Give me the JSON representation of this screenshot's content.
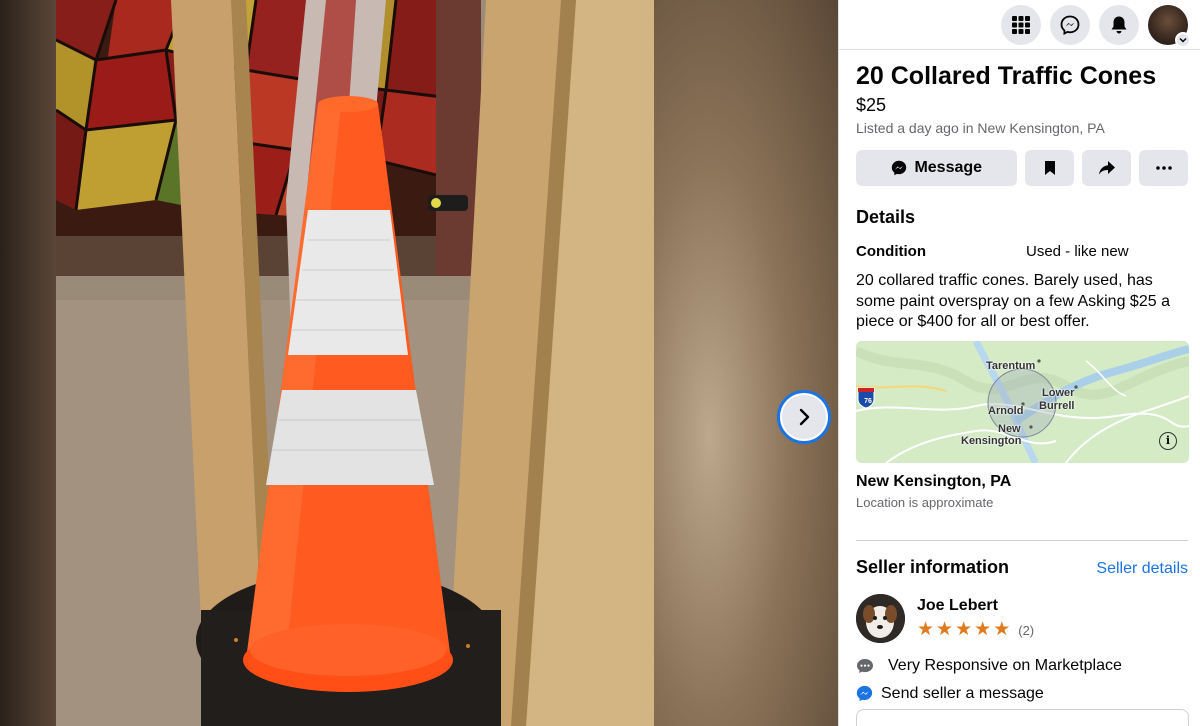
{
  "listing": {
    "title": "20 Collared Traffic Cones",
    "price": "$25",
    "listed": "Listed a day ago in New Kensington, PA"
  },
  "actions": {
    "message_label": "Message",
    "save_icon": "bookmark-icon",
    "share_icon": "share-icon",
    "more_icon": "more-icon"
  },
  "details": {
    "heading": "Details",
    "condition_label": "Condition",
    "condition_value": "Used - like new",
    "description": "20 collared traffic cones. Barely used, has some paint overspray on a few  Asking $25 a piece or $400 for all or best offer."
  },
  "map": {
    "labels": {
      "tarentum": "Tarentum",
      "lower": "Lower",
      "burrell": "Burrell",
      "arnold": "Arnold",
      "new": "New",
      "kensington": "Kensington"
    },
    "highway_shield": "76",
    "info": "i"
  },
  "location": {
    "name": "New Kensington, PA",
    "note": "Location is approximate"
  },
  "seller": {
    "heading": "Seller information",
    "details_link": "Seller details",
    "name": "Joe Lebert",
    "rating_stars": 5,
    "rating_count": "(2)",
    "responsive": "Very Responsive on Marketplace",
    "send_message": "Send seller a message"
  },
  "topbar": {
    "icons": [
      "menu-grid-icon",
      "messenger-icon",
      "notifications-bell-icon",
      "profile-avatar"
    ]
  },
  "colors": {
    "accent": "#1b74e4",
    "star": "#e07a1f",
    "secondary_text": "#65676b",
    "button_bg": "#e4e6eb"
  }
}
